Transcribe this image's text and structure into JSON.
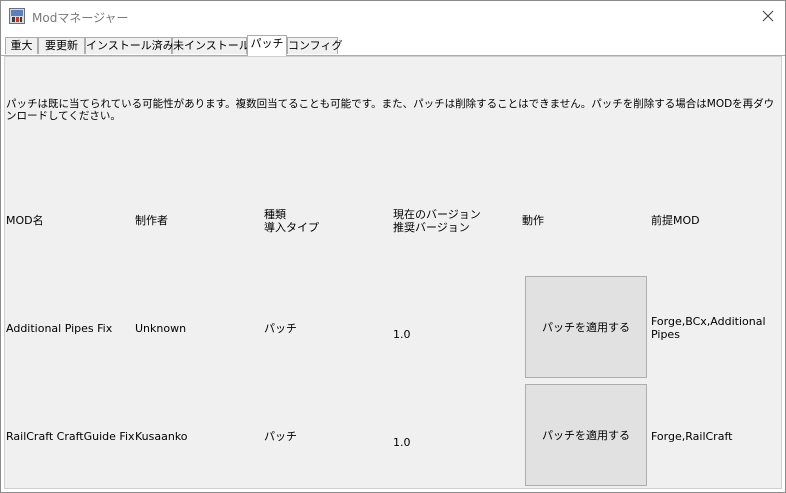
{
  "window": {
    "title": "Modマネージャー",
    "app_icon": "mod-manager-icon",
    "close_icon": "close-icon"
  },
  "tabs": [
    {
      "label": "重大"
    },
    {
      "label": "要更新"
    },
    {
      "label": "インストール済み"
    },
    {
      "label": "未インストール"
    },
    {
      "label": "パッチ"
    },
    {
      "label": "コンフィグ"
    }
  ],
  "active_tab": "パッチ",
  "notice": "パッチは既に当てられている可能性があります。複数回当てることも可能です。また、パッチは削除することはできません。パッチを削除する場合はMODを再ダウンロードしてください。",
  "columns": {
    "mod_name": "MOD名",
    "author": "制作者",
    "type_line1": "種類",
    "type_line2": "導入タイプ",
    "version_line1": "現在のバージョン",
    "version_line2": "推奨バージョン",
    "action": "動作",
    "prereq": "前提MOD"
  },
  "rows": [
    {
      "mod_name": "Additional Pipes Fix",
      "author": "Unknown",
      "type": "パッチ",
      "version": "1.0",
      "action_label": "パッチを適用する",
      "prereq": "Forge,BCx,Additional Pipes"
    },
    {
      "mod_name": "RailCraft CraftGuide Fix",
      "author": "Kusaanko",
      "type": "パッチ",
      "version": "1.0",
      "action_label": "パッチを適用する",
      "prereq": "Forge,RailCraft"
    }
  ]
}
